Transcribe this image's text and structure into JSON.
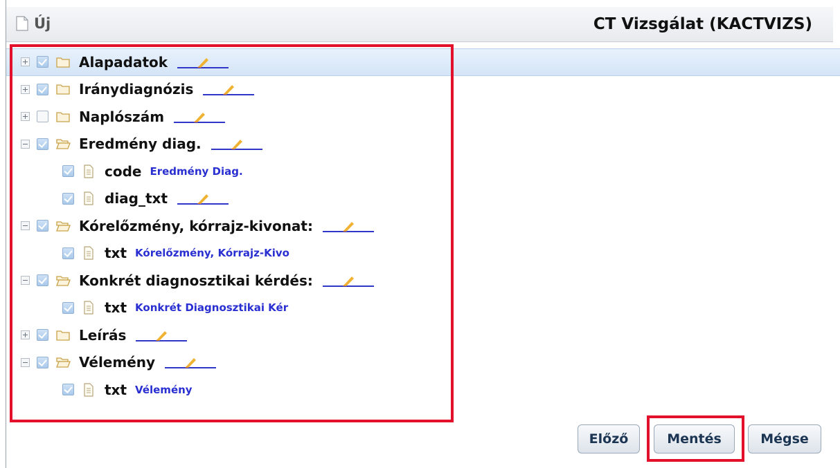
{
  "header": {
    "new_label": "Új",
    "title": "CT Vizsgálat (KACTVIZS)"
  },
  "tree": {
    "items": [
      {
        "label": "Alapadatok",
        "expanded": false,
        "checked": true,
        "selected": true
      },
      {
        "label": "Iránydiagnózis",
        "expanded": false,
        "checked": true
      },
      {
        "label": "Naplószám",
        "expanded": false,
        "checked": false
      },
      {
        "label": "Eredmény diag.",
        "expanded": true,
        "checked": true,
        "children": [
          {
            "label": "code",
            "value": "Eredmény Diag.",
            "checked": true
          },
          {
            "label": "diag_txt",
            "checked": true
          }
        ]
      },
      {
        "label": "Kórelőzmény, kórrajz-kivonat:",
        "expanded": true,
        "checked": true,
        "children": [
          {
            "label": "txt",
            "value": "Kórelőzmény, Kórrajz-Kivo",
            "checked": true
          }
        ]
      },
      {
        "label": "Konkrét diagnosztikai kérdés:",
        "expanded": true,
        "checked": true,
        "children": [
          {
            "label": "txt",
            "value": "Konkrét Diagnosztikai Kér",
            "checked": true
          }
        ]
      },
      {
        "label": "Leírás",
        "expanded": false,
        "checked": true
      },
      {
        "label": "Vélemény",
        "expanded": true,
        "checked": true,
        "children": [
          {
            "label": "txt",
            "value": "Vélemény",
            "checked": true
          }
        ]
      }
    ]
  },
  "buttons": {
    "prev": "Előző",
    "save": "Mentés",
    "cancel": "Mégse"
  },
  "colors": {
    "highlight": "#e2102a",
    "link": "#2a2fd1"
  }
}
